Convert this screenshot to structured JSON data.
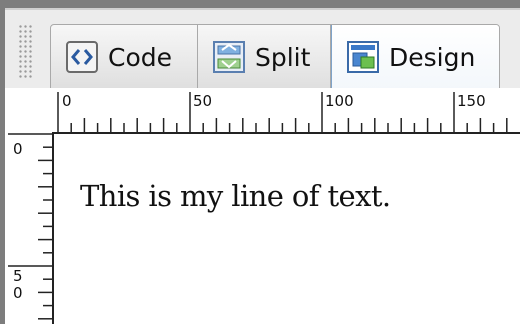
{
  "toolbar": {
    "views": [
      {
        "label": "Code",
        "icon": "code-view-icon",
        "active": false
      },
      {
        "label": "Split",
        "icon": "split-view-icon",
        "active": false
      },
      {
        "label": "Design",
        "icon": "design-view-icon",
        "active": true
      }
    ]
  },
  "ruler": {
    "horizontal_labels": [
      "0",
      "50",
      "100",
      "150"
    ],
    "vertical_labels": [
      "0",
      "50"
    ]
  },
  "canvas": {
    "text": "This is my line of text."
  }
}
